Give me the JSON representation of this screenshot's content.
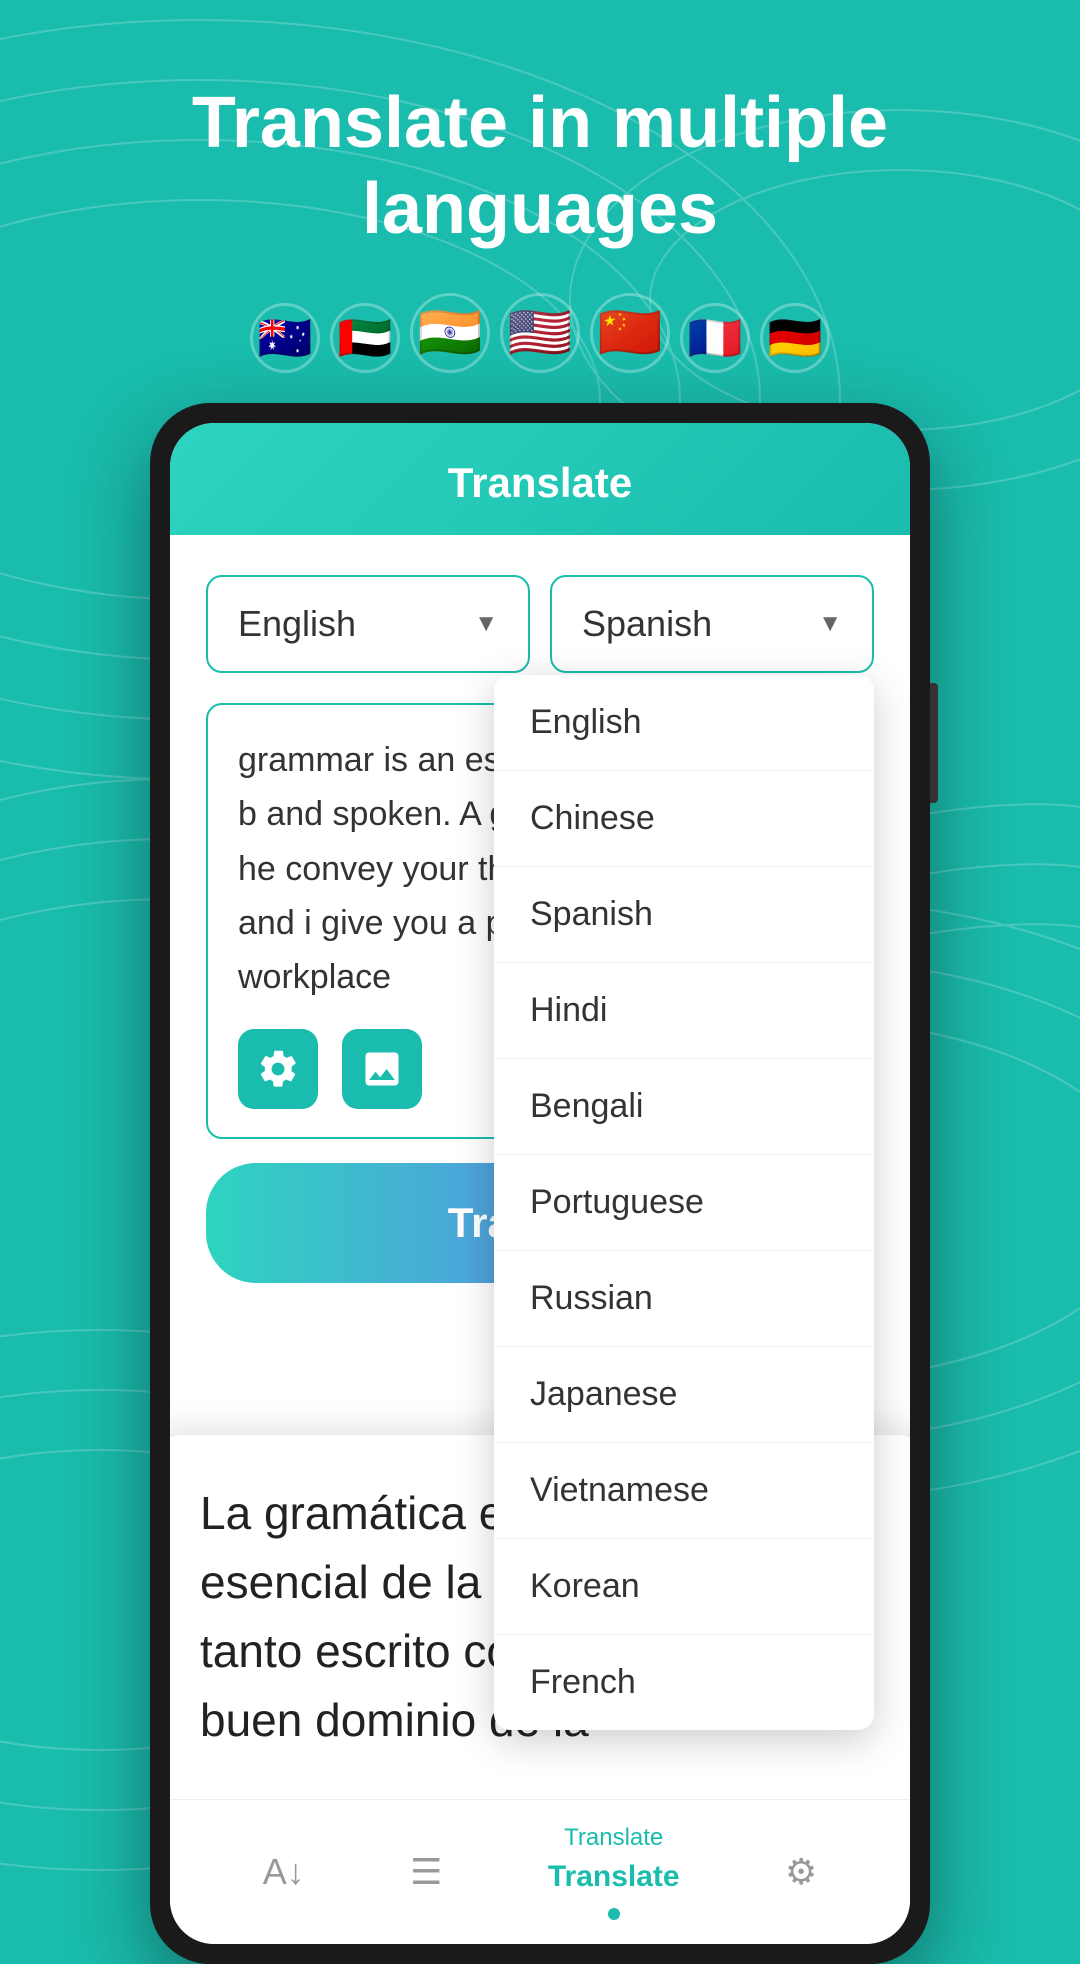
{
  "page": {
    "background_color": "#1ABCAD",
    "title": "Translate in multiple languages",
    "flags": [
      "🇦🇺",
      "🇦🇪",
      "🇮🇳",
      "🇺🇸",
      "🇨🇳",
      "🇫🇷",
      "🇩🇪"
    ]
  },
  "app": {
    "header_title": "Translate",
    "source_language": "English",
    "target_language": "Spanish",
    "input_text": "grammar is an esse of communication, b and spoken. A good of grammar can he convey your though and concisely, and i give you a professio the workplace",
    "translate_button_label": "Translate",
    "dropdown_languages": [
      "English",
      "Chinese",
      "Spanish",
      "Hindi",
      "Bengali",
      "Portuguese",
      "Russian",
      "Japanese",
      "Vietnamese",
      "Korean",
      "French"
    ],
    "translation_text": "La gramática es un aspecto esencial de la comunicación, tanto escrito como hablado. Un buen dominio de la"
  },
  "bottom_nav": {
    "items": [
      {
        "icon": "A↓",
        "label": "",
        "active": false
      },
      {
        "icon": "☰",
        "label": "",
        "active": false
      },
      {
        "icon": "Translate",
        "label": "Translate",
        "active": true
      },
      {
        "icon": "⚙",
        "label": "",
        "active": false
      }
    ]
  }
}
